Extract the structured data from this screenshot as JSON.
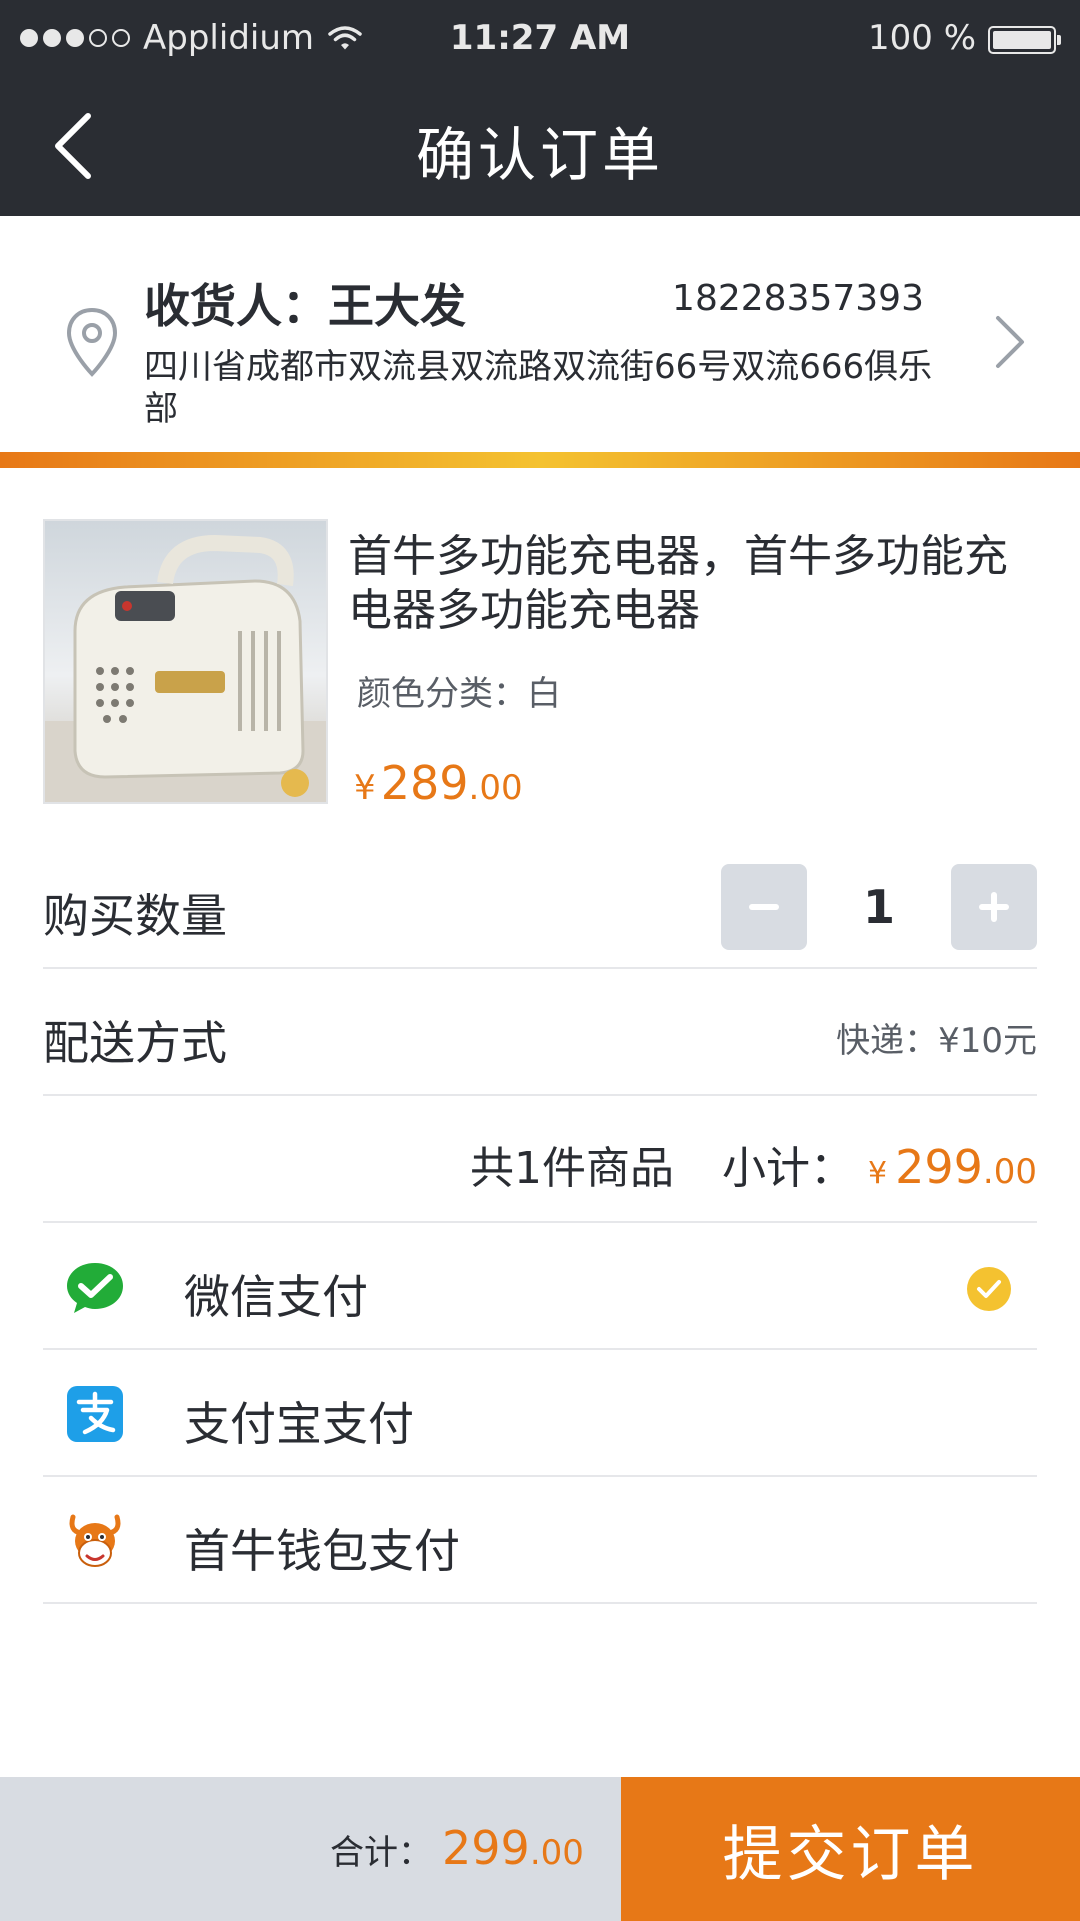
{
  "status_bar": {
    "carrier": "Applidium",
    "time": "11:27 AM",
    "battery": "100 %"
  },
  "nav": {
    "title": "确认订单",
    "back_icon": "chevron-left-icon"
  },
  "address": {
    "recipient_label": "收货人：",
    "recipient_name": "王大发",
    "phone": "18228357393",
    "address": "四川省成都市双流县双流路双流街66号双流666俱乐部",
    "pin_icon": "location-pin-icon",
    "arrow_icon": "chevron-right-icon"
  },
  "product": {
    "title": "首牛多功能充电器，首牛多功能充电器多功能充电器",
    "spec_label": "颜色分类：",
    "spec_value": "白",
    "price_currency": "¥",
    "price_int": "289",
    "price_dec": ".00"
  },
  "quantity": {
    "label": "购买数量",
    "value": "1"
  },
  "shipping": {
    "label": "配送方式",
    "value": "快递：¥10元"
  },
  "summary": {
    "count_text": "共1件商品",
    "subtotal_label": "小计：",
    "currency": "¥",
    "amount_int": "299",
    "amount_dec": ".00"
  },
  "payment": {
    "options": [
      {
        "label": "微信支付",
        "icon": "wechat-pay-icon",
        "selected": true
      },
      {
        "label": "支付宝支付",
        "icon": "alipay-icon",
        "selected": false
      },
      {
        "label": "首牛钱包支付",
        "icon": "shouniu-wallet-icon",
        "selected": false
      }
    ]
  },
  "bottom": {
    "total_label": "合计：",
    "total_int": "299",
    "total_dec": ".00",
    "submit_label": "提交订单"
  },
  "colors": {
    "dark": "#2A2D33",
    "gray_text": "#595E66",
    "accent": "#E77817",
    "check": "#F4C230",
    "button_gray": "#D8DCE2",
    "white": "#FFFFFF"
  }
}
